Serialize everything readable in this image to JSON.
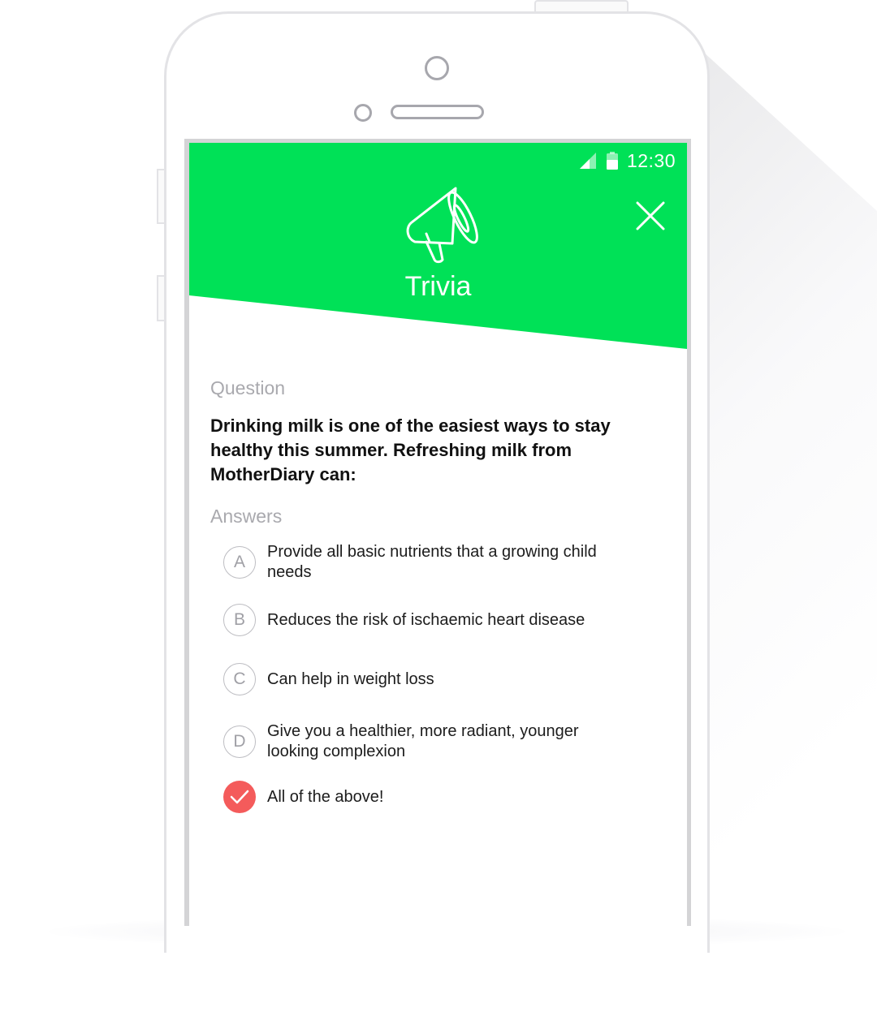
{
  "status_bar": {
    "time": "12:30"
  },
  "header": {
    "title": "Trivia",
    "icon": "megaphone-icon",
    "close_icon": "close-icon",
    "bg_color": "#00e157"
  },
  "question": {
    "label": "Question",
    "text": "Drinking milk is one of the easiest ways to stay healthy this summer. Refreshing milk from MotherDiary can:"
  },
  "answers": {
    "label": "Answers",
    "items": [
      {
        "letter": "A",
        "text": "Provide all basic nutrients that a growing child needs"
      },
      {
        "letter": "B",
        "text": "Reduces the risk of ischaemic heart disease"
      },
      {
        "letter": "C",
        "text": "Can help in weight loss"
      },
      {
        "letter": "D",
        "text": "Give you a healthier, more radiant, younger looking complexion"
      },
      {
        "letter": "",
        "text": "All of the above!",
        "selected": true,
        "icon": "check-icon"
      }
    ]
  },
  "colors": {
    "accent": "#00e157",
    "correct": "#f45b5b",
    "muted": "#a9a9ae"
  }
}
